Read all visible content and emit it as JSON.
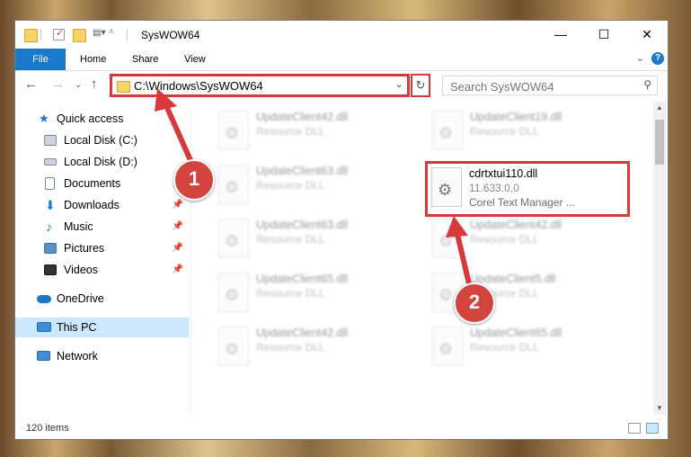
{
  "window": {
    "title": "SysWOW64",
    "controls": {
      "minimize": "—",
      "maximize": "☐",
      "close": "✕"
    }
  },
  "ribbon": {
    "tabs": [
      {
        "label": "File"
      },
      {
        "label": "Home"
      },
      {
        "label": "Share"
      },
      {
        "label": "View"
      }
    ],
    "help": "?"
  },
  "address": {
    "path": "C:\\Windows\\SysWOW64"
  },
  "search": {
    "placeholder": "Search SysWOW64"
  },
  "sidebar": {
    "items": [
      {
        "label": "Quick access"
      },
      {
        "label": "Local Disk (C:)"
      },
      {
        "label": "Local Disk (D:)"
      },
      {
        "label": "Documents"
      },
      {
        "label": "Downloads"
      },
      {
        "label": "Music"
      },
      {
        "label": "Pictures"
      },
      {
        "label": "Videos"
      },
      {
        "label": "OneDrive"
      },
      {
        "label": "This PC"
      },
      {
        "label": "Network"
      }
    ]
  },
  "files": [
    {
      "name": "UpdateClient42.dll",
      "type": "Resource DLL"
    },
    {
      "name": "UpdateClient19.dll",
      "type": "Resource DLL"
    },
    {
      "name": "UpdateClient63.dll",
      "type": "Resource DLL"
    },
    {
      "name": "cdrtxtui110.dll",
      "version": "11.633.0.0",
      "description": "Corel Text Manager ..."
    },
    {
      "name": "UpdateClient63.dll",
      "type": "Resource DLL"
    },
    {
      "name": "UpdateClient42.dll",
      "type": "Resource DLL"
    },
    {
      "name": "UpdateClient65.dll",
      "type": "Resource DLL"
    },
    {
      "name": "UpdateClient5.dll",
      "type": "Resource DLL"
    },
    {
      "name": "UpdateClient42.dll",
      "type": "Resource DLL"
    },
    {
      "name": "UpdateClient65.dll",
      "type": "Resource DLL"
    }
  ],
  "status": {
    "item_count": "120 items"
  },
  "callouts": {
    "one": "1",
    "two": "2"
  },
  "colors": {
    "highlight": "#d8393a",
    "accent": "#1979ca",
    "selected": "#cce8ff"
  }
}
